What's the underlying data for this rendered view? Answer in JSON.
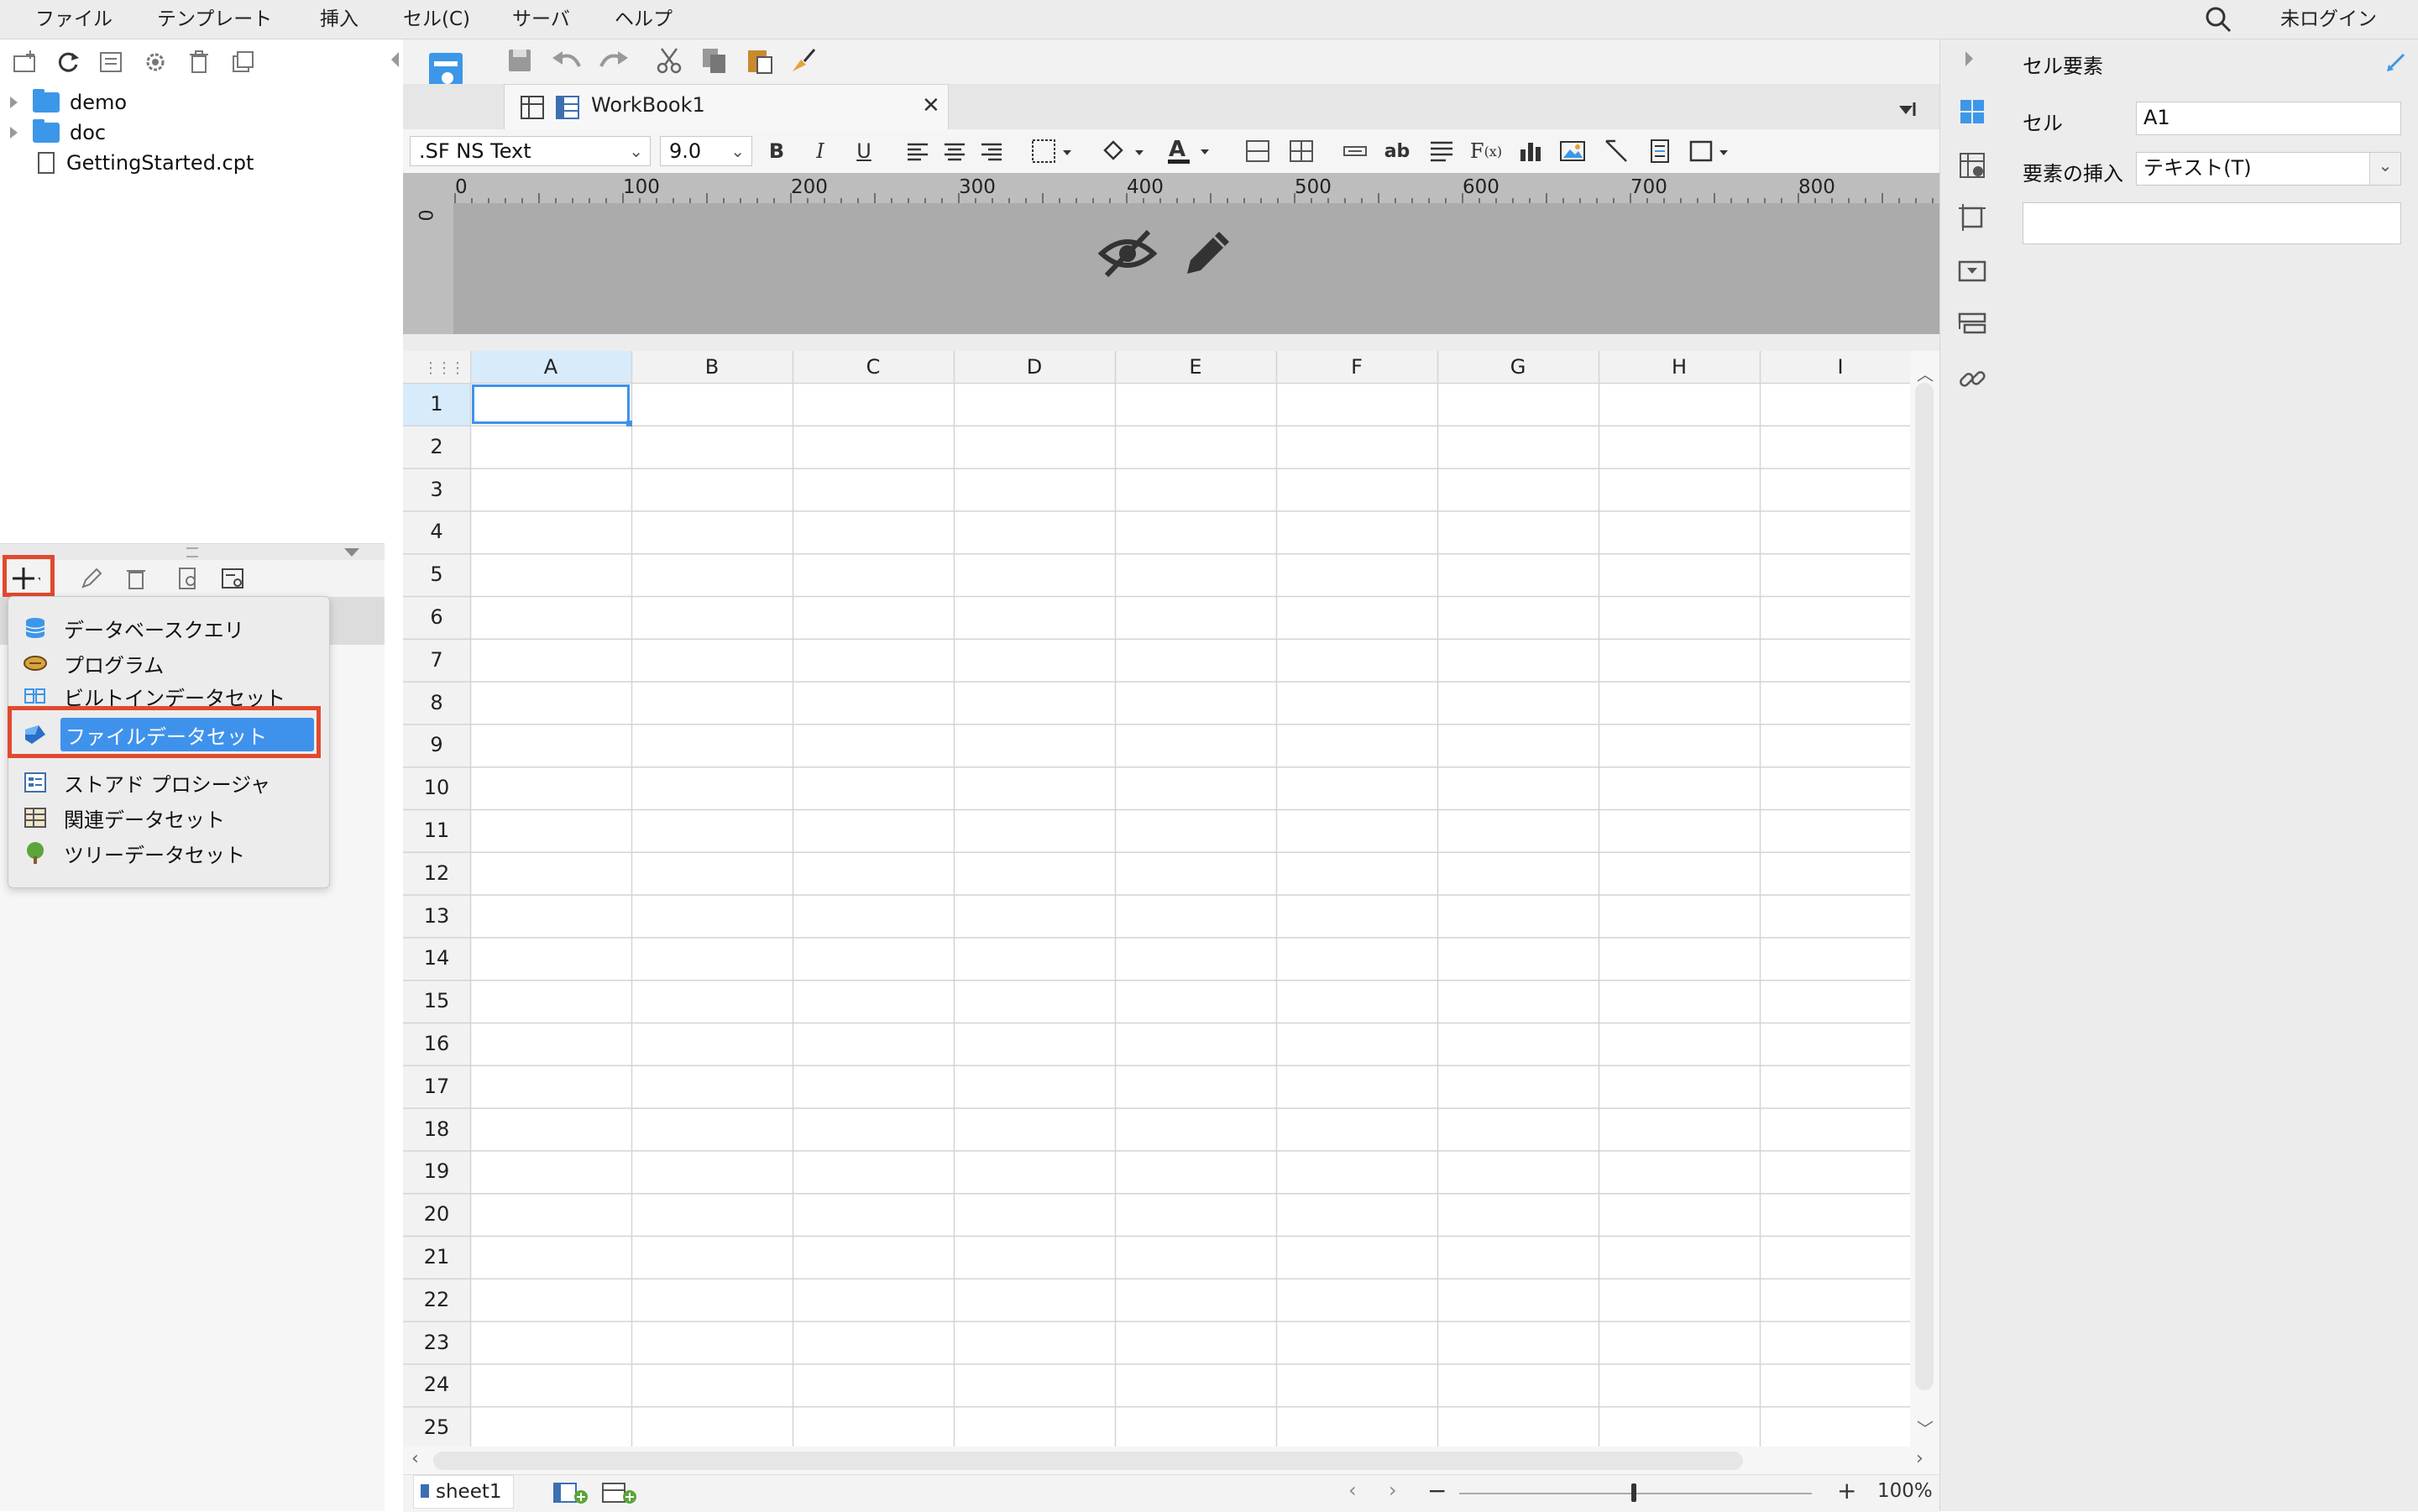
{
  "menu": [
    "ファイル",
    "テンプレート",
    "挿入",
    "セル(C)",
    "サーバ",
    "ヘルプ"
  ],
  "login": "未ログイン",
  "tree": {
    "items": [
      {
        "name": "demo",
        "type": "folder"
      },
      {
        "name": "doc",
        "type": "folder"
      },
      {
        "name": "GettingStarted.cpt",
        "type": "file"
      }
    ]
  },
  "dataset_menu": {
    "items": [
      {
        "label": "データベースクエリ",
        "icon": "database-icon",
        "color": "#3d97e8"
      },
      {
        "label": "プログラム",
        "icon": "program-icon",
        "color": "#c98a2e"
      },
      {
        "label": "ビルトインデータセット",
        "icon": "builtin-dataset-icon",
        "color": "#3d97e8"
      },
      {
        "label": "ファイルデータセット",
        "icon": "file-dataset-icon",
        "color": "#2a6fc9"
      },
      {
        "label": "ストアド プロシージャ",
        "icon": "stored-procedure-icon",
        "color": "#3d6fb0"
      },
      {
        "label": "関連データセット",
        "icon": "related-dataset-icon",
        "color": "#555555"
      },
      {
        "label": "ツリーデータセット",
        "icon": "tree-dataset-icon",
        "color": "#5aa63a"
      }
    ],
    "selected_index": 3,
    "highlight_color": "#e2492f",
    "selection_color": "#3f92ec"
  },
  "workbook_tab": "WorkBook1",
  "format": {
    "font": ".SF NS Text",
    "size": "9.0"
  },
  "ruler": [
    "0",
    "100",
    "200",
    "300",
    "400",
    "500",
    "600",
    "700",
    "800"
  ],
  "ruler_v": "0",
  "columns": [
    "A",
    "B",
    "C",
    "D",
    "E",
    "F",
    "G",
    "H",
    "I"
  ],
  "rows": [
    "1",
    "2",
    "3",
    "4",
    "5",
    "6",
    "7",
    "8",
    "9",
    "10",
    "11",
    "12",
    "13",
    "14",
    "15",
    "16",
    "17",
    "18",
    "19",
    "20",
    "21",
    "22",
    "23",
    "24",
    "25"
  ],
  "selected_cell": "A1",
  "sheet_tab": "sheet1",
  "zoom": "100%",
  "right_panel": {
    "title": "セル要素",
    "cell_label": "セル",
    "cell_value": "A1",
    "insert_label": "要素の挿入",
    "insert_value": "テキスト(T)"
  }
}
